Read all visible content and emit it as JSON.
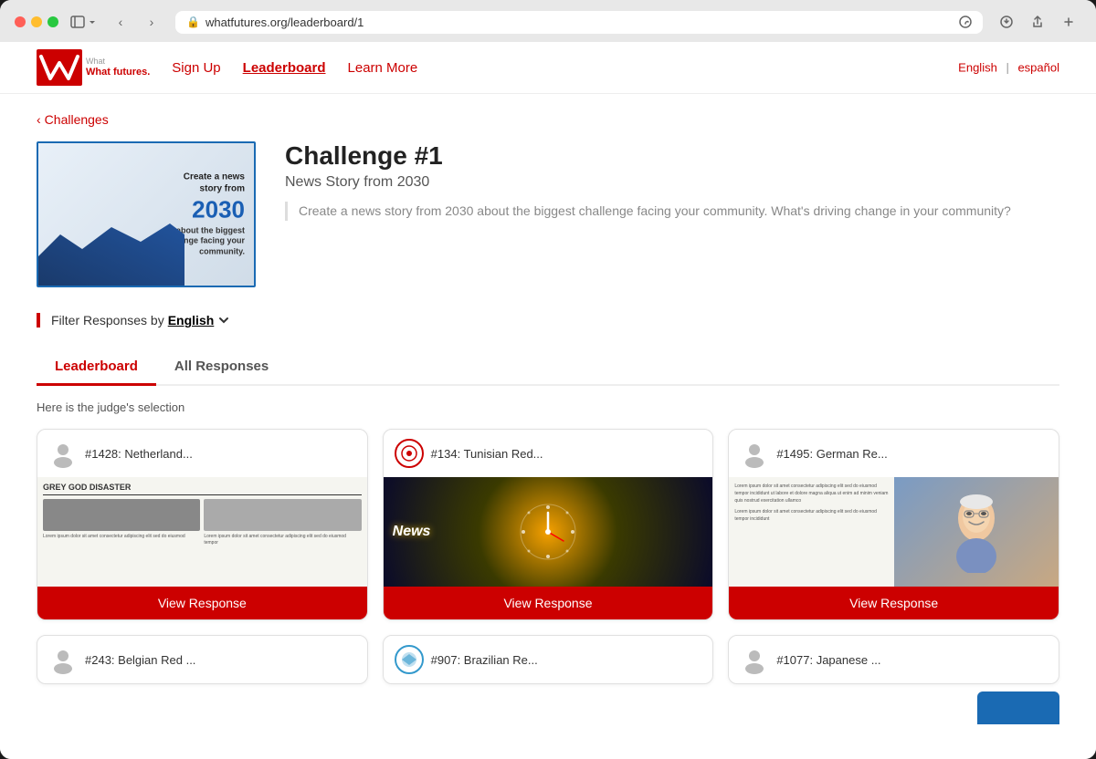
{
  "browser": {
    "url": "whatfutures.org/leaderboard/1"
  },
  "nav": {
    "logo_text": "What futures.",
    "links": [
      {
        "label": "Sign Up",
        "active": false
      },
      {
        "label": "Leaderboard",
        "active": true
      },
      {
        "label": "Learn More",
        "active": false
      }
    ],
    "lang_english": "English",
    "lang_spanish": "español"
  },
  "back_link": "Challenges",
  "challenge": {
    "title": "Challenge #1",
    "subtitle": "News Story from 2030",
    "description": "Create a news story from 2030 about the biggest challenge facing your community. What's driving change in your community?",
    "image_text_line1": "Create a news",
    "image_text_line2": "story from",
    "image_text_year": "2030",
    "image_text_line3": "about the biggest",
    "image_text_line4": "challenge facing your",
    "image_text_line5": "community."
  },
  "filter": {
    "label": "Filter Responses by",
    "selected": "English"
  },
  "tabs": [
    {
      "label": "Leaderboard",
      "active": true
    },
    {
      "label": "All Responses",
      "active": false
    }
  ],
  "judge_label": "Here is the judge's selection",
  "cards": [
    {
      "id": "#1428",
      "title": "#1428: Netherland...",
      "type": "newspaper",
      "headline": "GREY GOD DISASTER",
      "view_btn": "View Response"
    },
    {
      "id": "#134",
      "title": "#134: Tunisian Red...",
      "type": "news_clock",
      "view_btn": "View Response"
    },
    {
      "id": "#1495",
      "title": "#1495: German Re...",
      "type": "elder",
      "view_btn": "View Response"
    }
  ],
  "partial_cards": [
    {
      "id": "#243",
      "title": "#243: Belgian Red ..."
    },
    {
      "id": "#907",
      "title": "#907: Brazilian Re..."
    },
    {
      "id": "#1077",
      "title": "#1077: Japanese ..."
    }
  ]
}
